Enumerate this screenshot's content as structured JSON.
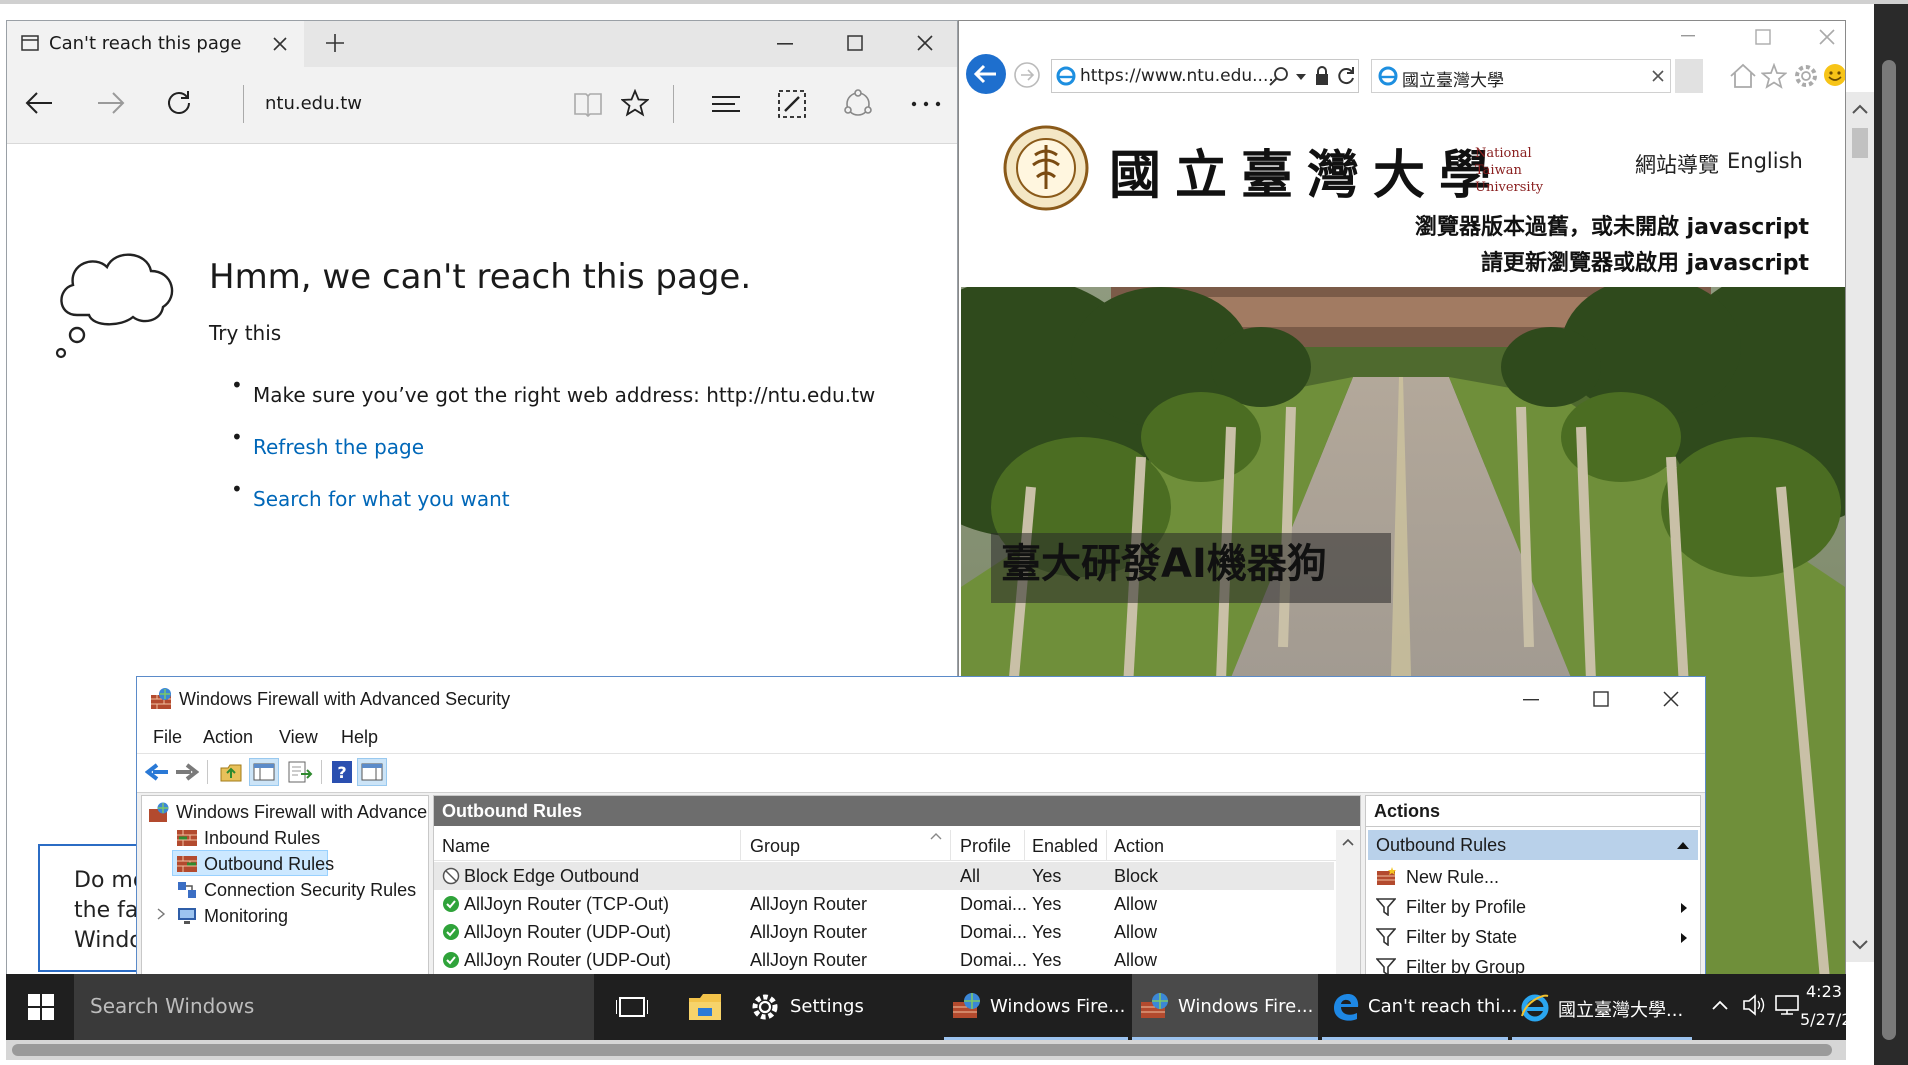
{
  "edge": {
    "tab_title": "Can't reach this page",
    "address": "ntu.edu.tw",
    "heading": "Hmm, we can't reach this page.",
    "try_this": "Try this",
    "bullet1": "Make sure you’ve got the right web address: http://ntu.edu.tw",
    "bullet2": "Refresh the page",
    "bullet3": "Search for what you want"
  },
  "ie": {
    "url": "https://www.ntu.edu....",
    "tab_title": "國立臺灣大學",
    "logo_cn": "國立臺灣大學",
    "logo_en1": "National",
    "logo_en2": "Taiwan",
    "logo_en3": "University",
    "nav_sitemap": "網站導覽",
    "nav_english": "English",
    "notice1": "瀏覽器版本過舊，或未開啟 javascript",
    "notice2": "請更新瀏覽器或啟用 javascript",
    "caption": "臺大研發AI機器狗"
  },
  "tooltip": {
    "line1": "Do mo",
    "line2": "the fas",
    "line3": "Windo"
  },
  "firewall": {
    "title": "Windows Firewall with Advanced Security",
    "menu": [
      "File",
      "Action",
      "View",
      "Help"
    ],
    "tree": {
      "root": "Windows Firewall with Advance",
      "inbound": "Inbound Rules",
      "outbound": "Outbound Rules",
      "connection": "Connection Security Rules",
      "monitoring": "Monitoring"
    },
    "center_header": "Outbound Rules",
    "columns": [
      "Name",
      "Group",
      "Profile",
      "Enabled",
      "Action"
    ],
    "rows": [
      {
        "name": "Block Edge Outbound",
        "group": "",
        "profile": "All",
        "enabled": "Yes",
        "action": "Block"
      },
      {
        "name": "AllJoyn Router (TCP-Out)",
        "group": "AllJoyn Router",
        "profile": "Domai...",
        "enabled": "Yes",
        "action": "Allow"
      },
      {
        "name": "AllJoyn Router (UDP-Out)",
        "group": "AllJoyn Router",
        "profile": "Domai...",
        "enabled": "Yes",
        "action": "Allow"
      },
      {
        "name": "AllJoyn Router (UDP-Out)",
        "group": "AllJoyn Router",
        "profile": "Domai...",
        "enabled": "Yes",
        "action": "Allow"
      }
    ],
    "actions_header": "Actions",
    "actions_section": "Outbound Rules",
    "actions": [
      "New Rule...",
      "Filter by Profile",
      "Filter by State",
      "Filter by Group"
    ]
  },
  "taskbar": {
    "search": "Search Windows",
    "settings": "Settings",
    "fw1": "Windows Fire...",
    "fw2": "Windows Fire...",
    "edge": "Can't reach thi...",
    "ie": "國立臺灣大學...",
    "time": "4:23",
    "date": "5/27/2"
  },
  "colors": {
    "edge_link": "#0067b8",
    "fw_selection": "#cce8ff",
    "taskbar": "#1f1f1f",
    "ie_back": "#1e6fce"
  }
}
